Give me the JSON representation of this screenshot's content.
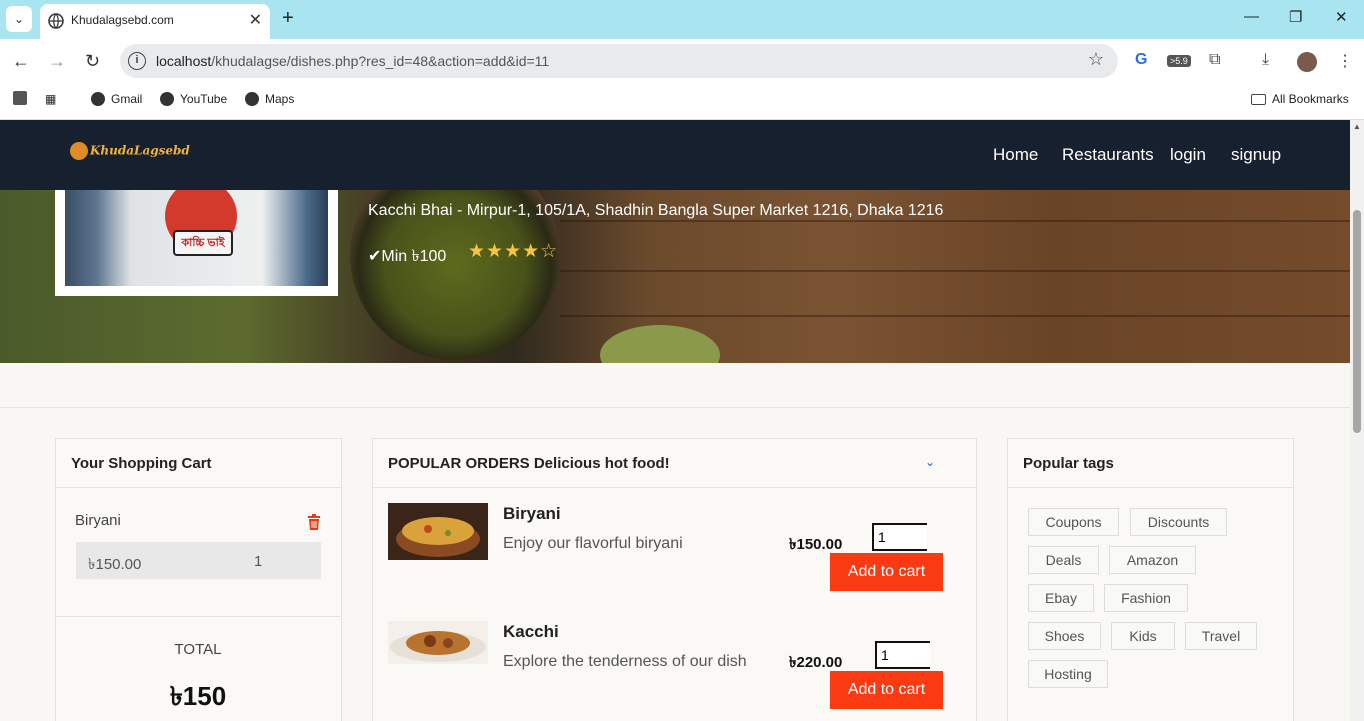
{
  "browser": {
    "tab_title": "Khudalagsebd.com",
    "url_host": "localhost",
    "url_path": "/khudalagse/dishes.php?res_id=48&action=add&id=11",
    "ext_badge": ">5.9",
    "bookmarks": [
      "Gmail",
      "YouTube",
      "Maps"
    ],
    "all_bookmarks": "All Bookmarks"
  },
  "site": {
    "logo_text": "KhudaLagsebd",
    "nav": [
      "Home",
      "Restaurants",
      "login",
      "signup"
    ]
  },
  "restaurant": {
    "sign_text": "কাচ্চি ভাই",
    "address": "Kacchi Bhai - Mirpur-1, 105/1A, Shadhin Bangla Super Market 1216, Dhaka 1216",
    "min_order": "Min ৳100",
    "rating": 4,
    "rating_max": 5
  },
  "cart": {
    "heading": "Your Shopping Cart",
    "items": [
      {
        "name": "Biryani",
        "price": "৳150.00",
        "qty": "1"
      }
    ],
    "total_label": "TOTAL",
    "total_value": "৳150"
  },
  "orders": {
    "heading": "POPULAR ORDERS Delicious hot food!",
    "dishes": [
      {
        "name": "Biryani",
        "desc": "Enjoy our flavorful biryani",
        "price": "৳150.00",
        "qty": "1",
        "button": "Add to cart"
      },
      {
        "name": "Kacchi",
        "desc": "Explore the tenderness of our dish",
        "price": "৳220.00",
        "qty": "1",
        "button": "Add to cart"
      }
    ]
  },
  "tags": {
    "heading": "Popular tags",
    "items": [
      "Coupons",
      "Discounts",
      "Deals",
      "Amazon",
      "Ebay",
      "Fashion",
      "Shoes",
      "Kids",
      "Travel",
      "Hosting"
    ]
  },
  "colors": {
    "nav_bg": "#17202e",
    "add_button": "#fa3a12",
    "star": "#f5c542",
    "trash": "#e53b1a"
  }
}
